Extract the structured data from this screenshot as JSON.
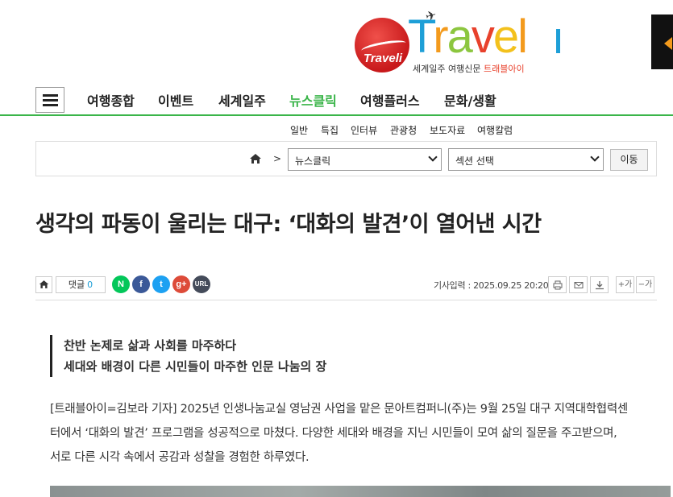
{
  "logo": {
    "circle_text": "Traveli",
    "word_letters": [
      "T",
      "r",
      "a",
      "v",
      "e",
      "l"
    ],
    "subtitle_main": "세계일주 여행신문",
    "subtitle_accent": "트래블아이",
    "colors": {
      "blue": "#1e9fd7",
      "orange": "#f39a1c",
      "green": "#8cc63f",
      "red": "#e8412c",
      "yellow": "#f3c11c"
    }
  },
  "nav": {
    "menu_icon": "hamburger-menu-icon",
    "items": [
      {
        "label": "여행종합",
        "active": false
      },
      {
        "label": "이벤트",
        "active": false
      },
      {
        "label": "세계일주",
        "active": false
      },
      {
        "label": "뉴스클릭",
        "active": true
      },
      {
        "label": "여행플러스",
        "active": false
      },
      {
        "label": "문화/생활",
        "active": false
      }
    ],
    "active_color": "#3bb54a"
  },
  "subnav": {
    "items": [
      "일반",
      "특집",
      "인터뷰",
      "관광청",
      "보도자료",
      "여행칼럼"
    ]
  },
  "breadcrumb": {
    "separator": ">",
    "section_select": "뉴스클릭",
    "subsection_select": "섹션 선택",
    "go_button": "이동"
  },
  "article": {
    "title": "생각의 파동이 울리는 대구: ‘대화의 발견’이 열어낸 시간",
    "comment_label": "댓글",
    "comment_count": "0",
    "share_buttons": [
      {
        "label": "N",
        "icon": "naver-icon",
        "color": "#03c75a"
      },
      {
        "label": "f",
        "icon": "facebook-icon",
        "color": "#3b5998"
      },
      {
        "label": "t",
        "icon": "twitter-icon",
        "color": "#1da1f2"
      },
      {
        "label": "g+",
        "icon": "google-plus-icon",
        "color": "#dd4b39"
      },
      {
        "label": "URL",
        "icon": "url-icon",
        "color": "#444b5a"
      }
    ],
    "date": "기사입력 : 2025.09.25 20:20",
    "font_increase": "+가",
    "font_decrease": "−가",
    "subheadlines": [
      "찬반 논제로 삶과 사회를 마주하다",
      "세대와 배경이 다른 시민들이 마주한 인문 나눔의 장"
    ],
    "body_lines": [
      "[트래블아이=김보라 기자] 2025년 인생나눔교실 영남권 사업을 맡은 문아트컴퍼니(주)는 9월 25일 대구 지역대학협력센",
      "터에서 ‘대화의 발견’ 프로그램을 성공적으로 마쳤다. 다양한 세대와 배경을 지닌 시민들이 모여 삶의 질문을 주고받으며,",
      "서로 다른 시각 속에서 공감과 성찰을 경험한 하루였다."
    ]
  }
}
